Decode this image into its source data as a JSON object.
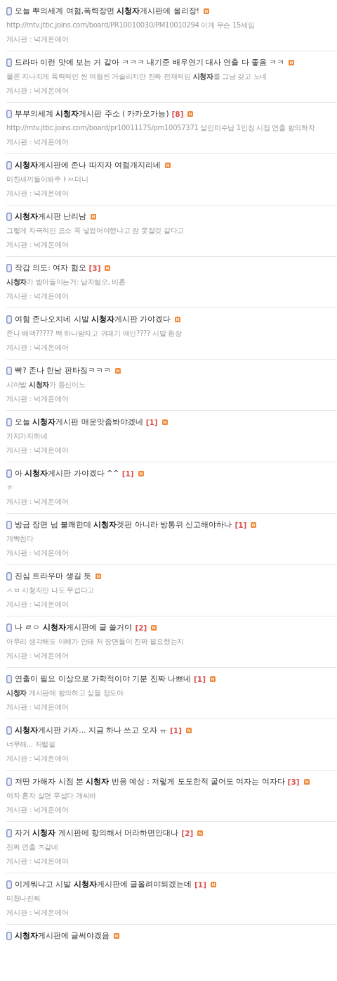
{
  "posts": [
    {
      "title": "오늘 뿌의세계 여혐,폭력장면 **시청자**게시판에 올리장!",
      "new": true,
      "preview": "http://mtv.jtbc.joins.com/board/PR10010030/PM10010294 이게 무슨 15세임",
      "board": "게시판 : 넉게온에어"
    },
    {
      "title": "드라마 이런 맛에 보는 거 같아 ㅋㅋㅋ 내기준 배우연기 대사 연출 다 좋음 ㅋㅋ",
      "new": true,
      "preview": "물론 지나치게 폭력적인 씬 여혐씬 거슬리지만 진짜 전재적임 **시청자**를 그냥 갖고 노네",
      "board": "게시판 : 넉게온에어"
    },
    {
      "title": "부부의세계 **시청자**게시판 주소 ( 카카오가능)",
      "comments": "[8]",
      "new": true,
      "preview": "http://mtv.jtbc.joins.com/board/pr10011175/pm10057371 살인미수남 1인칭 시점 연출 항의하자",
      "board": "게시판 : 넉게온에어"
    },
    {
      "title": "**시청자**게시판에 존나 따지자 여혐개지리네",
      "new": true,
      "preview": "미친새끼들이봐주ㅑㅆ더니",
      "board": "게시판 : 넉게온에어"
    },
    {
      "title": "**시청자**게시판 난리남",
      "new": true,
      "preview": "그렇게 자극적인 요소 꼭 넣었어야했냐고 잠 못잘것 같다고",
      "board": "게시판 : 넉게온에어"
    },
    {
      "title": "작감 의도: 여자 혐오",
      "comments": "[3]",
      "new": true,
      "preview": "**시청자**가 받아들이는거: 남자혐오, 비혼",
      "board": "게시판 : 넉게온에어"
    },
    {
      "title": "여혐 존나오지네 시발 **시청자**게시판 가야겠다",
      "new": true,
      "preview": "존나 배액????? 백 하나받자고 귀때기 애인???? 시발 환장",
      "board": "게시판 : 넉게온에어"
    },
    {
      "title": "빡? 존나 한남 판타짘ㅋㅋㅋ",
      "new": true,
      "preview": "시이발 **시청자**가 등신이노",
      "board": "게시판 : 넉게온에어"
    },
    {
      "title": "오늘 **시청자**게시판 매운맛좀봐야겠네",
      "comments": "[1]",
      "new": true,
      "preview": "가지가지하네",
      "board": "게시판 : 넉게온에어"
    },
    {
      "title": "아 **시청자**게시판 가야겠다 ^^",
      "comments": "[1]",
      "new": true,
      "preview": "ㅎ",
      "board": "게시판 : 넉게온에어"
    },
    {
      "title": "방금 장면 넘 불쾌한데 **시청자**겟판 아니라 방통위 신고해야하나",
      "comments": "[1]",
      "new": true,
      "preview": "개빡친다",
      "board": "게시판 : 넉게온에어"
    },
    {
      "title": "진심 트라우마 생길 듯",
      "new": true,
      "preview": "ㅅㅂ 시청자인 나도 무섭다고",
      "board": "게시판 : 넉게온에어"
    },
    {
      "title": "나 ㄹㅇ **시청자**게시판에 글 쓸거야",
      "comments": "[2]",
      "new": true,
      "preview": "아무리 생각해도 이해가 안돼 저 장면들이 진짜 필요했는지",
      "board": "게시판 : 넉게온에어"
    },
    {
      "title": "연출이 필요 이상으로 가학적이야 기분 진짜 나쁘네",
      "comments": "[1]",
      "new": true,
      "preview": "**시청자** 게시판에 항의하고 싶을 정도야",
      "board": "게시판 : 넉게온에어"
    },
    {
      "title": "**시청자**게시판 가자... 지금 하나 쓰고 오자 ㅠ",
      "comments": "[1]",
      "new": true,
      "preview": "너무해... 저럴필",
      "board": "게시판 : 넉게온에어"
    },
    {
      "title": "저딴 가해자 시점 본 **시청자** 반응 예상 : 저렇게 도도한적 굴어도 여자는 여자다",
      "comments": "[3]",
      "new": true,
      "preview": "여자 혼자 살면 무섭다 개씨바",
      "board": "게시판 : 넉게온에어"
    },
    {
      "title": "자거 **시청자** 게시판에 항의해서 머라하면안대나",
      "comments": "[2]",
      "new": true,
      "preview": "진짜 연출 ㅈ같네",
      "board": "게시판 : 넉게온에어"
    },
    {
      "title": "이게뭐냐고 시발 **시청자**게시판에 글올려야되겠는데",
      "comments": "[1]",
      "new": true,
      "preview": "미쳤나진짜",
      "board": "게시판 : 넉게온에어"
    },
    {
      "title": "**시청자**게시판에 글써야겠음",
      "new": true
    }
  ]
}
